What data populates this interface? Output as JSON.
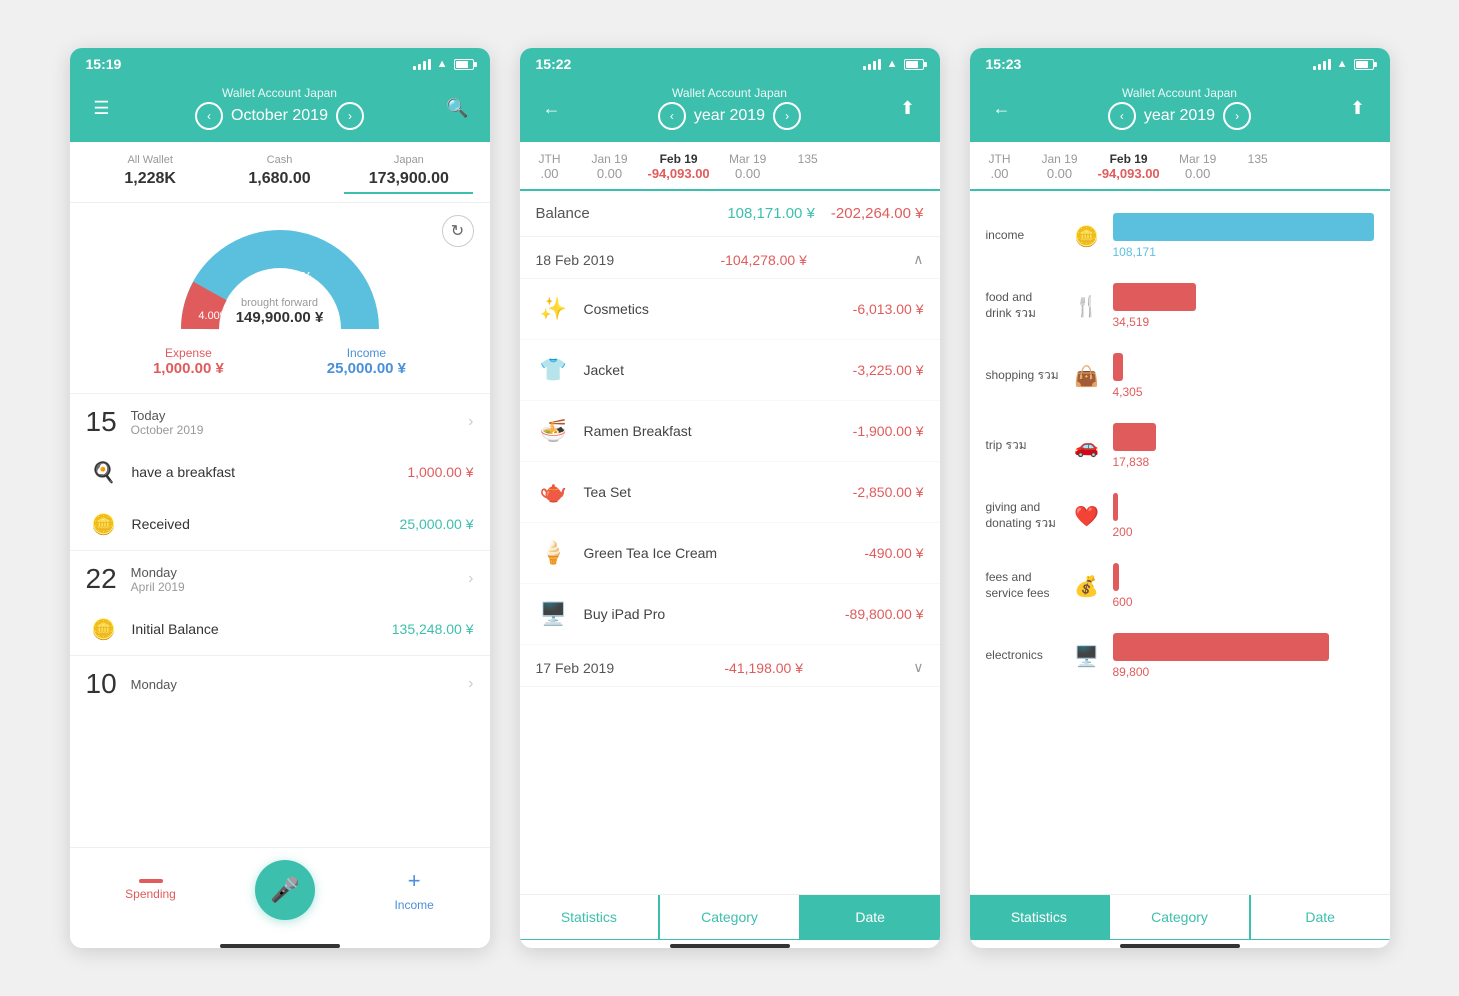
{
  "phone1": {
    "statusBar": {
      "time": "15:19"
    },
    "header": {
      "title": "Wallet Account Japan",
      "subtitle": "October 2019"
    },
    "balanceTabs": [
      {
        "label": "All Wallet",
        "value": "1,228K",
        "active": false
      },
      {
        "label": "Cash",
        "value": "1,680.00",
        "active": false
      },
      {
        "label": "Japan",
        "value": "173,900.00",
        "active": true
      }
    ],
    "chart": {
      "percent": "96.00%",
      "percent2": "4.00%",
      "broughtForward": "brought forward",
      "amount": "149,900.00 ¥"
    },
    "expense": {
      "label": "Expense",
      "amount": "1,000.00 ¥"
    },
    "income": {
      "label": "Income",
      "amount": "25,000.00 ¥"
    },
    "dateGroups": [
      {
        "day": "15",
        "label": "Today",
        "month": "October 2019",
        "transactions": [
          {
            "icon": "🍳",
            "name": "have a breakfast",
            "amount": "1,000.00 ¥",
            "type": "expense"
          },
          {
            "icon": "🪙",
            "name": "Received",
            "amount": "25,000.00 ¥",
            "type": "income"
          }
        ]
      },
      {
        "day": "22",
        "label": "Monday",
        "month": "April 2019",
        "transactions": [
          {
            "icon": "🪙",
            "name": "Initial Balance",
            "amount": "135,248.00 ¥",
            "type": "income"
          }
        ]
      },
      {
        "day": "10",
        "label": "Monday",
        "month": "",
        "transactions": []
      }
    ],
    "bottomNav": {
      "spending": "Spending",
      "income": "Income"
    }
  },
  "phone2": {
    "statusBar": {
      "time": "15:22"
    },
    "header": {
      "title": "Wallet Account Japan",
      "subtitle": "year 2019"
    },
    "monthTabs": [
      {
        "label": "JTH",
        "amount": ".00"
      },
      {
        "label": "Jan 19",
        "amount": "0.00"
      },
      {
        "label": "Feb 19",
        "amount": "-94,093.00",
        "active": true
      },
      {
        "label": "Mar 19",
        "amount": "0.00"
      },
      {
        "label": "135",
        "amount": ""
      }
    ],
    "balance": {
      "label": "Balance",
      "posAmount": "108,171.00 ¥",
      "negAmount": "-202,264.00 ¥"
    },
    "dateGroups": [
      {
        "date": "18 Feb 2019",
        "total": "-104,278.00 ¥",
        "items": [
          {
            "icon": "✨",
            "name": "Cosmetics",
            "amount": "-6,013.00 ¥"
          },
          {
            "icon": "👕",
            "name": "Jacket",
            "amount": "-3,225.00 ¥"
          },
          {
            "icon": "🍜",
            "name": "Ramen Breakfast",
            "amount": "-1,900.00 ¥"
          },
          {
            "icon": "🫖",
            "name": "Tea Set",
            "amount": "-2,850.00 ¥"
          },
          {
            "icon": "🍦",
            "name": "Green Tea Ice Cream",
            "amount": "-490.00 ¥"
          },
          {
            "icon": "🖥️",
            "name": "Buy iPad Pro",
            "amount": "-89,800.00 ¥"
          }
        ]
      },
      {
        "date": "17 Feb 2019",
        "total": "-41,198.00 ¥",
        "items": []
      }
    ],
    "bottomTabs": [
      {
        "label": "Statistics",
        "active": false
      },
      {
        "label": "Category",
        "active": false
      },
      {
        "label": "Date",
        "active": true
      }
    ]
  },
  "phone3": {
    "statusBar": {
      "time": "15:23"
    },
    "header": {
      "title": "Wallet Account Japan",
      "subtitle": "year 2019"
    },
    "monthTabs": [
      {
        "label": "JTH",
        "amount": ".00"
      },
      {
        "label": "Jan 19",
        "amount": "0.00"
      },
      {
        "label": "Feb 19",
        "amount": "-94,093.00",
        "active": true
      },
      {
        "label": "Mar 19",
        "amount": "0.00"
      },
      {
        "label": "135",
        "amount": ""
      }
    ],
    "categories": [
      {
        "name": "income",
        "icon": "🪙",
        "value": 108171,
        "maxVal": 108171,
        "displayVal": "108,171",
        "type": "income"
      },
      {
        "name": "food and drink รวม",
        "icon": "🍴",
        "value": 34519,
        "maxVal": 108171,
        "displayVal": "34,519",
        "type": "expense"
      },
      {
        "name": "shopping รวม",
        "icon": "👜",
        "value": 4305,
        "maxVal": 108171,
        "displayVal": "4,305",
        "type": "expense"
      },
      {
        "name": "trip รวม",
        "icon": "🚗",
        "value": 17838,
        "maxVal": 108171,
        "displayVal": "17,838",
        "type": "expense"
      },
      {
        "name": "giving and donating รวม",
        "icon": "❤️",
        "value": 200,
        "maxVal": 108171,
        "displayVal": "200",
        "type": "expense"
      },
      {
        "name": "fees and service fees",
        "icon": "💰",
        "value": 600,
        "maxVal": 108171,
        "displayVal": "600",
        "type": "expense"
      },
      {
        "name": "electronics",
        "icon": "🖥️",
        "value": 89800,
        "maxVal": 108171,
        "displayVal": "89,800",
        "type": "expense"
      }
    ],
    "bottomTabs": [
      {
        "label": "Statistics",
        "active": true
      },
      {
        "label": "Category",
        "active": false
      },
      {
        "label": "Date",
        "active": false
      }
    ]
  }
}
